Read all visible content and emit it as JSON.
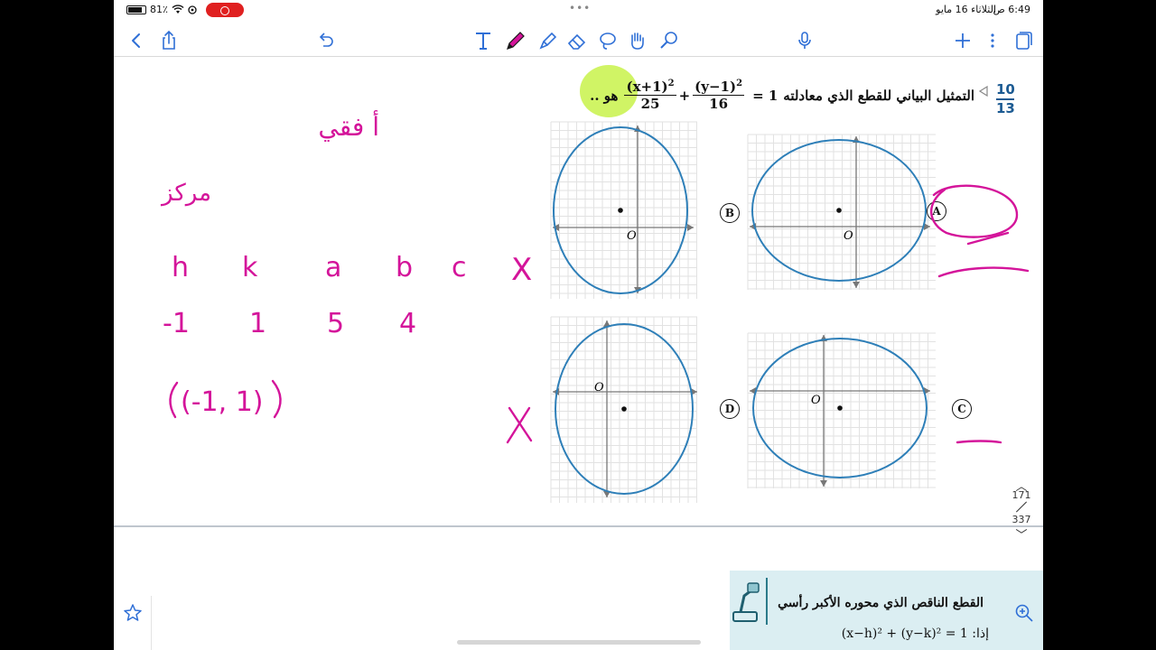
{
  "status_bar": {
    "time": "6:49 ص",
    "date": "الثلاثاء 16 مايو",
    "battery": "81٪",
    "battery_level": 0.81
  },
  "toolbar": {
    "icons": [
      "back-icon",
      "share-icon",
      "undo-icon",
      "text-tool-icon",
      "pen-icon",
      "highlighter-icon",
      "eraser-icon",
      "lasso-icon",
      "hand-icon",
      "laser-icon",
      "microphone-icon",
      "add-icon",
      "more-icon",
      "pages-icon"
    ]
  },
  "question": {
    "counter_top": "10",
    "counter_bottom": "13",
    "prefix": "التمثيل البياني للقطع الذي معادلته",
    "equals": "1 =",
    "frac1_num": "(x+1)",
    "frac1_exp": "2",
    "frac1_den": "25",
    "plus": "+",
    "frac2_num": "(y−1)",
    "frac2_exp": "2",
    "frac2_den": "16",
    "suffix": "هو .."
  },
  "options": {
    "a": "A",
    "b": "B",
    "c": "C",
    "d": "D"
  },
  "graph_labels": {
    "origin": "O"
  },
  "handwriting": {
    "word1": "أ فقي",
    "word2": "مركز",
    "headers": [
      "h",
      "k",
      "a",
      "b",
      "c",
      "X"
    ],
    "values": [
      "-1",
      "1",
      "5",
      "4"
    ],
    "center": "(-1, 1)",
    "cross": "X"
  },
  "scroller": {
    "current": "171",
    "total": "337"
  },
  "preview": {
    "title": "القطع الناقص الذي محوره الأكبر رأسي",
    "formula": "(x−h)² + (y−k)² = 1 :إذا"
  },
  "colors": {
    "ink": "#d4149a",
    "highlight": "#c8f24a",
    "ellipse": "#2e7fb8",
    "accent": "#1b5a92"
  }
}
